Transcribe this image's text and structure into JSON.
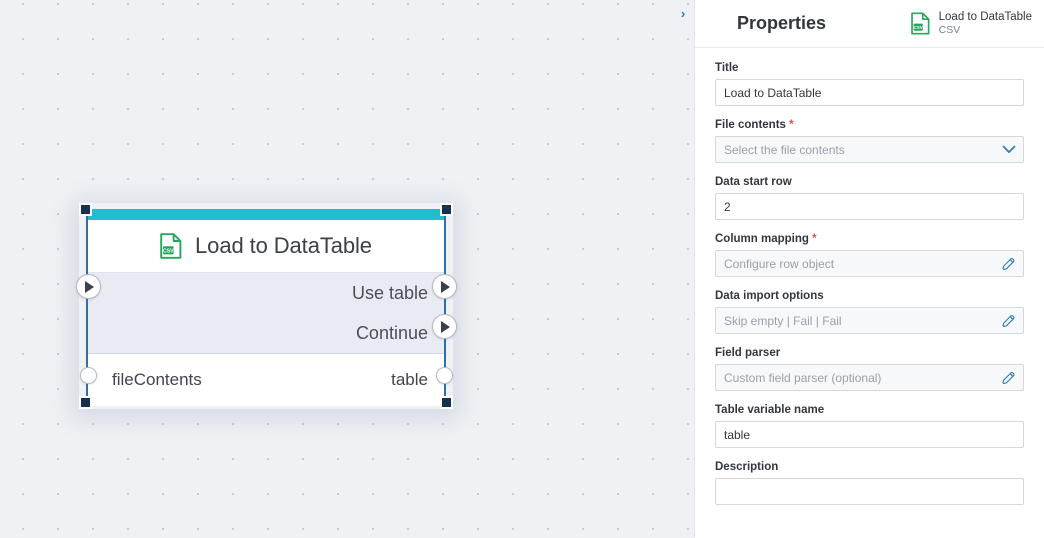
{
  "canvas": {
    "node": {
      "title": "Load to DataTable",
      "icon": "csv-file-icon",
      "accent_color": "#22bccd",
      "selected_border_color": "#2f6fad",
      "exec_outputs": [
        {
          "label": "Use table"
        },
        {
          "label": "Continue"
        }
      ],
      "data_input": {
        "label": "fileContents"
      },
      "data_output": {
        "label": "table"
      }
    }
  },
  "panel": {
    "collapse_icon": "chevron-right-icon",
    "collapse_glyph": "›",
    "title": "Properties",
    "header_item": {
      "icon": "csv-file-icon",
      "name": "Load to DataTable",
      "subtitle": "CSV"
    },
    "fields": [
      {
        "label": "Title",
        "required": false,
        "value": "Load to DataTable",
        "placeholder": "",
        "adorn": "none",
        "muted": false
      },
      {
        "label": "File contents",
        "required": true,
        "value": "",
        "placeholder": "Select the file contents",
        "adorn": "chevron-down-icon",
        "muted": true
      },
      {
        "label": "Data start row",
        "required": false,
        "value": "2",
        "placeholder": "",
        "adorn": "none",
        "muted": false
      },
      {
        "label": "Column mapping",
        "required": true,
        "value": "",
        "placeholder": "Configure row object",
        "adorn": "pencil-icon",
        "muted": true
      },
      {
        "label": "Data import options",
        "required": false,
        "value": "",
        "placeholder": "Skip empty | Fail | Fail",
        "adorn": "pencil-icon",
        "muted": true
      },
      {
        "label": "Field parser",
        "required": false,
        "value": "",
        "placeholder": "Custom field parser (optional)",
        "adorn": "pencil-icon",
        "muted": true
      },
      {
        "label": "Table variable name",
        "required": false,
        "value": "table",
        "placeholder": "",
        "adorn": "none",
        "muted": false
      },
      {
        "label": "Description",
        "required": false,
        "value": "",
        "placeholder": "",
        "adorn": "none",
        "muted": false
      }
    ]
  },
  "colors": {
    "canvas_bg": "#eff1f5",
    "node_accent": "#22bccd",
    "selection": "#2f6fad",
    "handle": "#16324f",
    "accent_blue": "#2e7cb8",
    "csv_green": "#26a65b",
    "required_red": "#d9534f"
  }
}
